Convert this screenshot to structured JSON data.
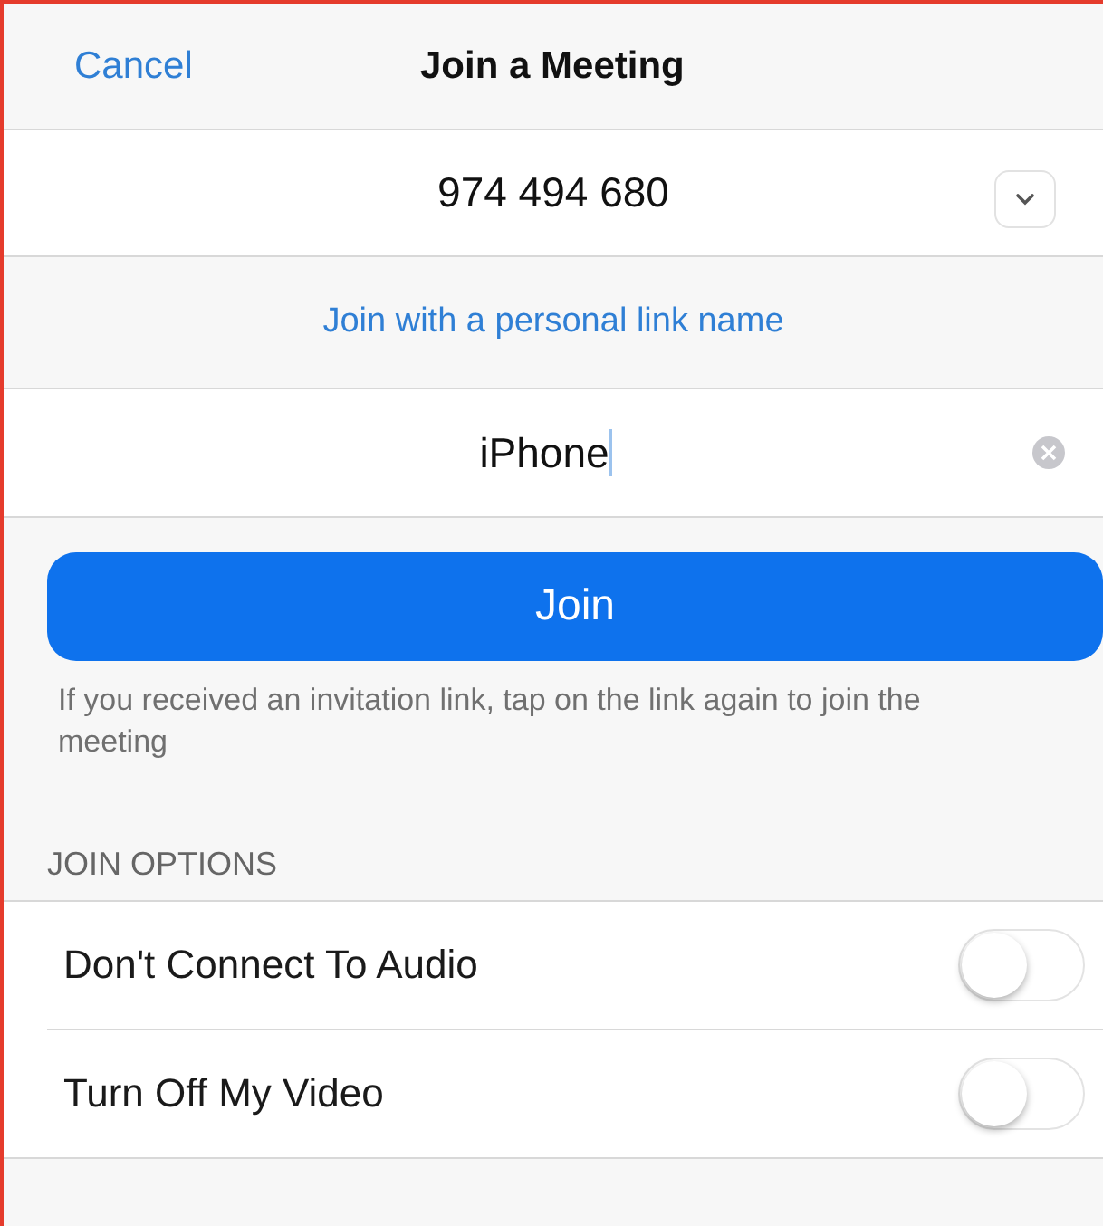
{
  "nav": {
    "cancel": "Cancel",
    "title": "Join a Meeting"
  },
  "meeting_id": {
    "value": "974 494 680"
  },
  "personal_link": "Join with a personal link name",
  "name_field": {
    "value": "iPhone"
  },
  "join_button": "Join",
  "hint": "If you received an invitation link, tap on the link again to join the meeting",
  "section_title": "JOIN OPTIONS",
  "options": [
    {
      "label": "Don't Connect To Audio",
      "on": false
    },
    {
      "label": "Turn Off My Video",
      "on": false
    }
  ]
}
